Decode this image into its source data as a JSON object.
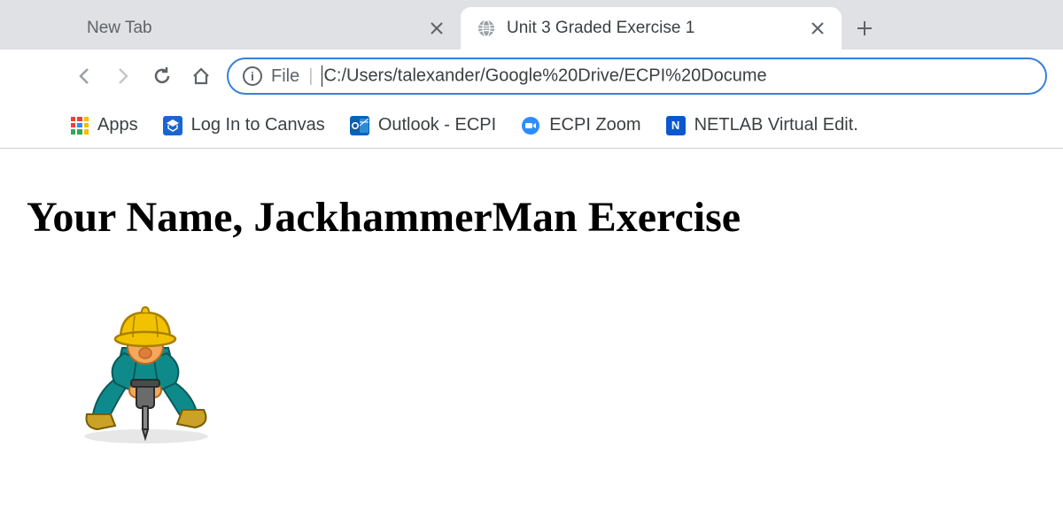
{
  "tabs": {
    "inactive": {
      "title": "New Tab"
    },
    "active": {
      "title": "Unit 3 Graded Exercise 1"
    }
  },
  "addressBar": {
    "scheme": "File",
    "path": "C:/Users/talexander/Google%20Drive/ECPI%20Docume"
  },
  "bookmarksBar": {
    "appsLabel": "Apps",
    "items": [
      {
        "label": "Log In to Canvas"
      },
      {
        "label": "Outlook - ECPI"
      },
      {
        "label": "ECPI Zoom"
      },
      {
        "label": "NETLAB Virtual Edit."
      }
    ]
  },
  "page": {
    "heading": "Your Name, JackhammerMan Exercise"
  }
}
